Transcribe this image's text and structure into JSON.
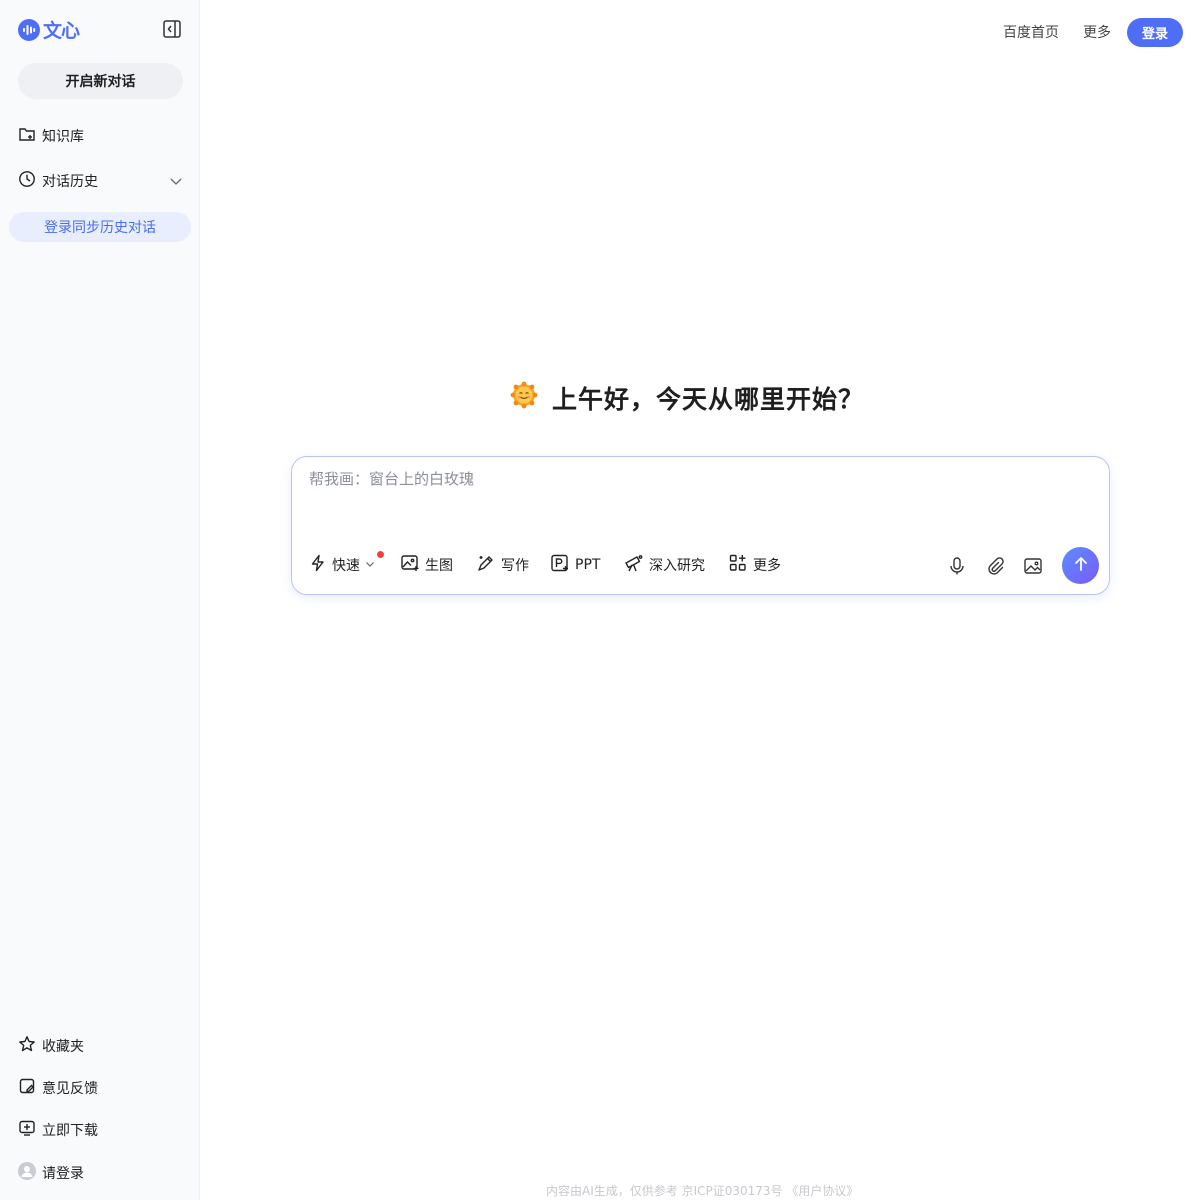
{
  "brand": {
    "name": "文心",
    "color": "#4f6ef7"
  },
  "sidebar": {
    "new_chat_label": "开启新对话",
    "knowledge_base": "知识库",
    "history": "对话历史",
    "sync_label": "登录同步历史对话",
    "bottom": {
      "favorites": "收藏夹",
      "feedback": "意见反馈",
      "download": "立即下载",
      "login": "请登录"
    },
    "icons": [
      "folder-icon",
      "clock-icon",
      "chevron-down-icon",
      "star-icon",
      "feedback-icon",
      "download-icon",
      "user-avatar-icon",
      "sidebar-collapse-icon"
    ]
  },
  "header": {
    "baidu_home": "百度首页",
    "more": "更多",
    "login": "登录"
  },
  "main": {
    "greeting_emoji": "🌞",
    "greeting": "上午好，今天从哪里开始？",
    "input": {
      "placeholder": "帮我画：窗台上的白玫瑰",
      "value": ""
    },
    "tools": {
      "fast": "快速",
      "image": "生图",
      "write": "写作",
      "ppt": "PPT",
      "research": "深入研究",
      "more": "更多"
    },
    "tool_icons": [
      "lightning-icon",
      "image-generate-icon",
      "pen-icon",
      "ppt-icon",
      "telescope-icon",
      "apps-icon",
      "microphone-icon",
      "paperclip-icon",
      "image-upload-icon",
      "arrow-up-icon"
    ]
  },
  "footer": {
    "text": "内容由AI生成，仅供参考 京ICP证030173号 《用户协议》"
  }
}
